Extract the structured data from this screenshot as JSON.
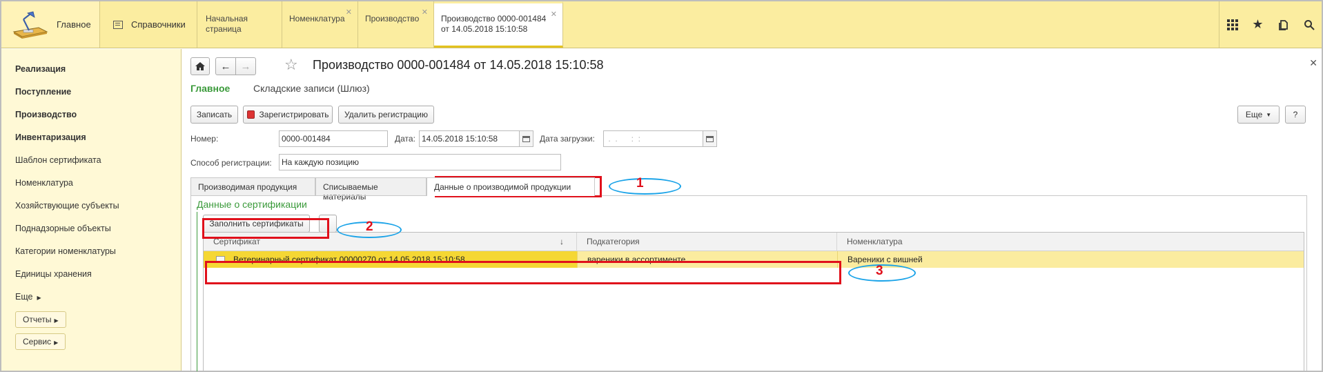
{
  "top": {
    "main_label": "Главное",
    "reference_label": "Справочники",
    "tabs": [
      {
        "label": "Начальная страница",
        "closable": false
      },
      {
        "label": "Номенклатура",
        "closable": true
      },
      {
        "label": "Производство",
        "closable": true
      },
      {
        "label": "Производство 0000-001484 от 14.05.2018 15:10:58",
        "closable": true
      }
    ]
  },
  "sidebar": {
    "items": [
      {
        "label": "Реализация",
        "bold": true
      },
      {
        "label": "Поступление",
        "bold": true
      },
      {
        "label": "Производство",
        "bold": true
      },
      {
        "label": "Инвентаризация",
        "bold": true
      },
      {
        "label": "Шаблон сертификата"
      },
      {
        "label": "Номенклатура"
      },
      {
        "label": "Хозяйствующие субъекты"
      },
      {
        "label": "Поднадзорные объекты"
      },
      {
        "label": "Категории номенклатуры"
      },
      {
        "label": "Единицы хранения"
      }
    ],
    "more_label": "Еще",
    "reports_label": "Отчеты",
    "service_label": "Сервис"
  },
  "doc": {
    "title": "Производство 0000-001484 от 14.05.2018 15:10:58",
    "nav_main": "Главное",
    "nav_link": "Складские записи (Шлюз)",
    "buttons": {
      "write": "Записать",
      "register": "Зарегистрировать",
      "unregister": "Удалить регистрацию",
      "more": "Еще",
      "help": "?"
    },
    "fields": {
      "number_label": "Номер:",
      "number_value": "0000-001484",
      "date_label": "Дата:",
      "date_value": "14.05.2018 15:10:58",
      "load_date_label": "Дата загрузки:",
      "load_date_value": " .  .      :  :",
      "reg_method_label": "Способ регистрации:",
      "reg_method_value": "На каждую позицию"
    },
    "form_tabs": [
      "Производимая продукция",
      "Списываемые материалы",
      "Данные о производимой продукции"
    ],
    "section_title": "Данные о сертификации",
    "fill_button": "Заполнить сертификаты",
    "table": {
      "columns": [
        "Сертификат",
        "Подкатегория",
        "Номенклатура"
      ],
      "sort_indicator": "↓",
      "rows": [
        {
          "certificate": "Ветеринарный сертификат 00000270 от 14.05.2018 15:10:58",
          "subcategory": "вареники в ассортименте",
          "nomenclature": "Вареники с вишней"
        }
      ]
    }
  },
  "annotations": {
    "labels": [
      "1",
      "2",
      "3"
    ],
    "mark_color": "#e0101b",
    "ellipse_color": "#1aa3e8"
  },
  "colors": {
    "topbar": "#fbeda0",
    "sidebar": "#fff9d6",
    "accent_green": "#3a9a3a",
    "selected_row": "#f5d734"
  }
}
